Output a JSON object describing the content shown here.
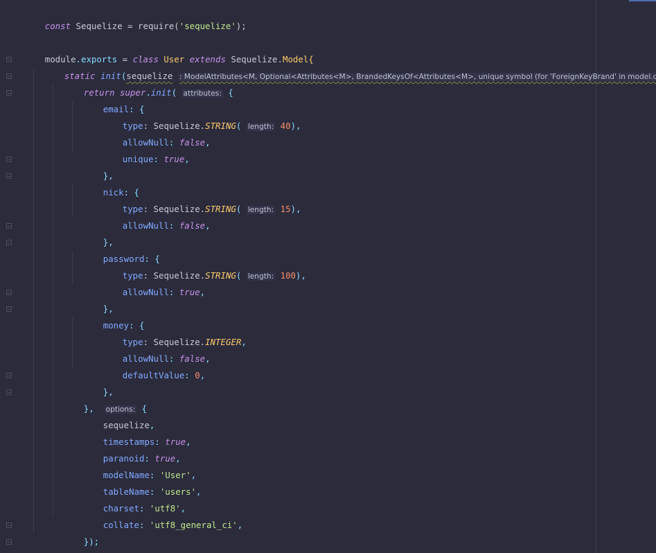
{
  "editor": {
    "lines": {
      "l1": {
        "kw": "const",
        "a": " Sequelize = require(",
        "s": "'sequelize'",
        "b": ");"
      },
      "l3": {
        "a": "module",
        "b": ".",
        "c": "exports",
        "d": " = ",
        "e": "class",
        "f": " ",
        "g": "User",
        "h": " ",
        "i": "extends",
        "j": " Sequelize.",
        "k": "Model",
        "l": "{"
      },
      "l4": {
        "a": "static",
        "b": " ",
        "c": "init",
        "d": "(",
        "e": "sequelize",
        "f": " ",
        "hint": ": ModelAttributes<M, Optional<Attributes<M>, BrandedKeysOf<Attributes<M>, unique symbol (for 'ForeignKeyBrand' in model.d.ts)>>>",
        "g": " ",
        "h": ")",
        "i": "{"
      },
      "l5": {
        "a": "return",
        "b": " ",
        "c": "super",
        "d": ".",
        "e": "init",
        "f": "( ",
        "hint": "attributes:",
        "g": " {"
      },
      "l6": {
        "a": "email",
        "b": ": {"
      },
      "l7": {
        "a": "type",
        "b": ": Sequelize.",
        "c": "STRING",
        "d": "( ",
        "hint": "length:",
        "e": " ",
        "f": "40",
        "g": "),"
      },
      "l8": {
        "a": "allowNull",
        "b": ": ",
        "c": "false",
        "d": ","
      },
      "l9": {
        "a": "unique",
        "b": ": ",
        "c": "true",
        "d": ","
      },
      "l10": {
        "a": "},"
      },
      "l11": {
        "a": "nick",
        "b": ": {"
      },
      "l12": {
        "a": "type",
        "b": ": Sequelize.",
        "c": "STRING",
        "d": "( ",
        "hint": "length:",
        "e": " ",
        "f": "15",
        "g": "),"
      },
      "l13": {
        "a": "allowNull",
        "b": ": ",
        "c": "false",
        "d": ","
      },
      "l14": {
        "a": "},"
      },
      "l15": {
        "a": "password",
        "b": ": {"
      },
      "l16": {
        "a": "type",
        "b": ": Sequelize.",
        "c": "STRING",
        "d": "( ",
        "hint": "length:",
        "e": " ",
        "f": "100",
        "g": "),"
      },
      "l17": {
        "a": "allowNull",
        "b": ": ",
        "c": "true",
        "d": ","
      },
      "l18": {
        "a": "},"
      },
      "l19": {
        "a": "money",
        "b": ": {"
      },
      "l20": {
        "a": "type",
        "b": ": Sequelize.",
        "c": "INTEGER",
        "d": ","
      },
      "l21": {
        "a": "allowNull",
        "b": ": ",
        "c": "false",
        "d": ","
      },
      "l22": {
        "a": "defaultValue",
        "b": ": ",
        "c": "0",
        "d": ","
      },
      "l23": {
        "a": "},"
      },
      "l24": {
        "a": "},",
        "b": "  ",
        "hint": "options:",
        "c": " {"
      },
      "l25": {
        "a": "sequelize",
        "b": ","
      },
      "l26": {
        "a": "timestamps",
        "b": ": ",
        "c": "true",
        "d": ","
      },
      "l27": {
        "a": "paranoid",
        "b": ": ",
        "c": "true",
        "d": ","
      },
      "l28": {
        "a": "modelName",
        "b": ": ",
        "c": "'User'",
        "d": ","
      },
      "l29": {
        "a": "tableName",
        "b": ": ",
        "c": "'users'",
        "d": ","
      },
      "l30": {
        "a": "charset",
        "b": ": ",
        "c": "'utf8'",
        "d": ","
      },
      "l31": {
        "a": "collate",
        "b": ": ",
        "c": "'utf8_general_ci'",
        "d": ","
      },
      "l32": {
        "a": "});"
      },
      "l33": {
        "a": "}"
      }
    }
  }
}
